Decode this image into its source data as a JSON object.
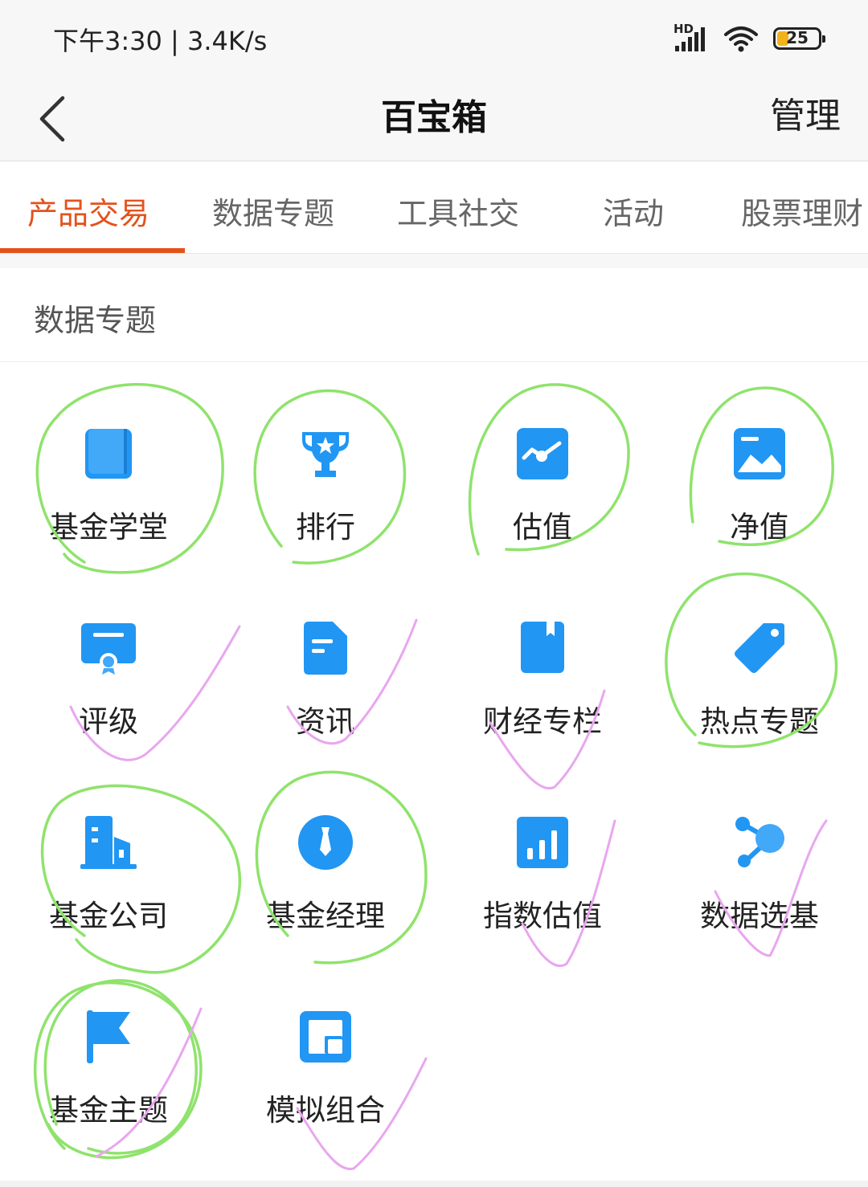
{
  "status_bar": {
    "time_speed": "下午3:30 | 3.4K/s",
    "network": "HD",
    "battery": "25",
    "battery_level": 0.25,
    "icons": [
      "signal-icon",
      "wifi-icon",
      "battery-icon"
    ]
  },
  "nav": {
    "back_icon": "chevron-left-icon",
    "title": "百宝箱",
    "manage": "管理"
  },
  "tabs": [
    {
      "label": "产品交易",
      "active": true
    },
    {
      "label": "数据专题",
      "active": false
    },
    {
      "label": "工具社交",
      "active": false
    },
    {
      "label": "活动",
      "active": false
    },
    {
      "label": "股票理财",
      "active": false
    }
  ],
  "section": {
    "title": "数据专题",
    "items": [
      {
        "label": "基金学堂",
        "icon": "book-icon"
      },
      {
        "label": "排行",
        "icon": "trophy-icon"
      },
      {
        "label": "估值",
        "icon": "trend-chart-icon"
      },
      {
        "label": "净值",
        "icon": "image-chart-icon"
      },
      {
        "label": "评级",
        "icon": "certificate-icon"
      },
      {
        "label": "资讯",
        "icon": "document-icon"
      },
      {
        "label": "财经专栏",
        "icon": "bookmark-icon"
      },
      {
        "label": "热点专题",
        "icon": "tag-icon"
      },
      {
        "label": "基金公司",
        "icon": "building-icon"
      },
      {
        "label": "基金经理",
        "icon": "tie-icon"
      },
      {
        "label": "指数估值",
        "icon": "bar-chart-icon"
      },
      {
        "label": "数据选基",
        "icon": "share-nodes-icon"
      },
      {
        "label": "基金主题",
        "icon": "flag-icon"
      },
      {
        "label": "模拟组合",
        "icon": "portfolio-icon"
      }
    ]
  },
  "colors": {
    "accent": "#e4521c",
    "icon_blue": "#2196f3",
    "annotation_green": "#8fe36c",
    "annotation_pink": "#e9a6ef"
  }
}
